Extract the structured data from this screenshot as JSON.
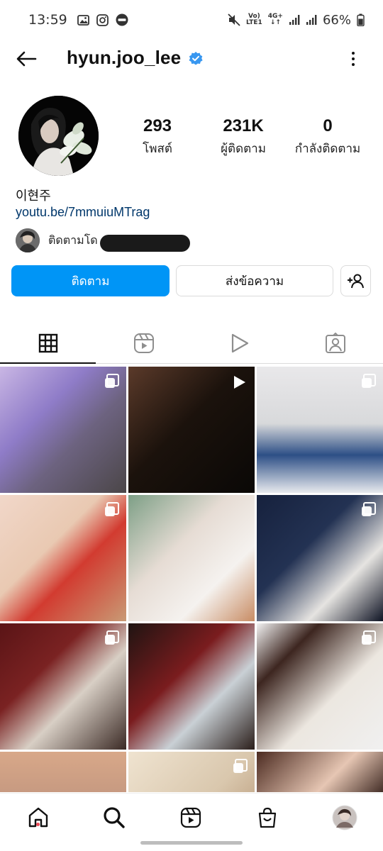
{
  "status_bar": {
    "time": "13:59",
    "network_top": "Vo)",
    "network_bottom": "LTE1",
    "signal_label_top": "4G+",
    "battery": "66%"
  },
  "header": {
    "username": "hyun.joo_lee",
    "verified_icon": "verified-badge-icon",
    "verified_color": "#3897f0"
  },
  "stats": {
    "posts": {
      "value": "293",
      "label": "โพสต์"
    },
    "followers": {
      "value": "231K",
      "label": "ผู้ติดตาม"
    },
    "following": {
      "value": "0",
      "label": "กำลังติดตาม"
    }
  },
  "bio": {
    "name": "이현주",
    "link": "youtu.be/7mmuiuMTrag",
    "followed_by": "ติดตามโด"
  },
  "actions": {
    "follow": "ติดตาม",
    "message": "ส่งข้อความ",
    "follow_color": "#0095f6"
  },
  "tabs": [
    "grid-icon",
    "reels-icon",
    "video-icon",
    "tagged-icon"
  ],
  "grid": {
    "posts": [
      {
        "type": "multi",
        "bg": "linear-gradient(135deg,#c9b6e4 0%,#8f7cc8 35%,#6d6380 60%,#4b4648 100%)"
      },
      {
        "type": "reel",
        "bg": "linear-gradient(135deg,#5b3a2a 0%,#1b120c 45%,#0a0806 100%)"
      },
      {
        "type": "multi",
        "bg": "linear-gradient(180deg,#e9e8ea 0%,#d8d9db 45%,#2d4f86 70%,#e8eaee 100%)"
      },
      {
        "type": "multi",
        "bg": "linear-gradient(135deg,#f1d7c9 0%,#e9c9b2 40%,#d23b30 60%,#c99a75 100%)"
      },
      {
        "type": "none",
        "bg": "linear-gradient(135deg,#7d9f86 0%,#e6dcd4 40%,#f5f2ef 70%,#c88c64 100%)"
      },
      {
        "type": "multi",
        "bg": "linear-gradient(135deg,#16213d 0%,#233253 40%,#e6e4e1 70%,#0f1424 100%)"
      },
      {
        "type": "multi",
        "bg": "linear-gradient(135deg,#5a1416 0%,#7a2222 35%,#d8cfc5 60%,#3b2a25 100%)"
      },
      {
        "type": "none",
        "bg": "linear-gradient(135deg,#1f1412 0%,#7a1c1e 40%,#c9d0d5 65%,#2a1e1a 100%)"
      },
      {
        "type": "multi",
        "bg": "linear-gradient(135deg,#f2f2f2 0%,#3d2620 25%,#ece7e0 60%,#f0f0f0 100%)"
      },
      {
        "type": "none",
        "bg": "linear-gradient(180deg,#d8a889 0%,#b98e7a 60%,#6d5d5c 100%)"
      },
      {
        "type": "multi",
        "bg": "linear-gradient(135deg,#efe3d0 0%,#d9c7ad 50%,#a57f5c 100%)"
      },
      {
        "type": "none",
        "bg": "linear-gradient(135deg,#4c2b21 0%,#e6c6b3 40%,#2b1712 70%,#d9b59d 100%)"
      }
    ]
  },
  "bottom_nav": [
    "home-icon",
    "search-icon",
    "reels-icon",
    "shop-icon",
    "profile-avatar"
  ],
  "accent_notification": "#ed4956"
}
